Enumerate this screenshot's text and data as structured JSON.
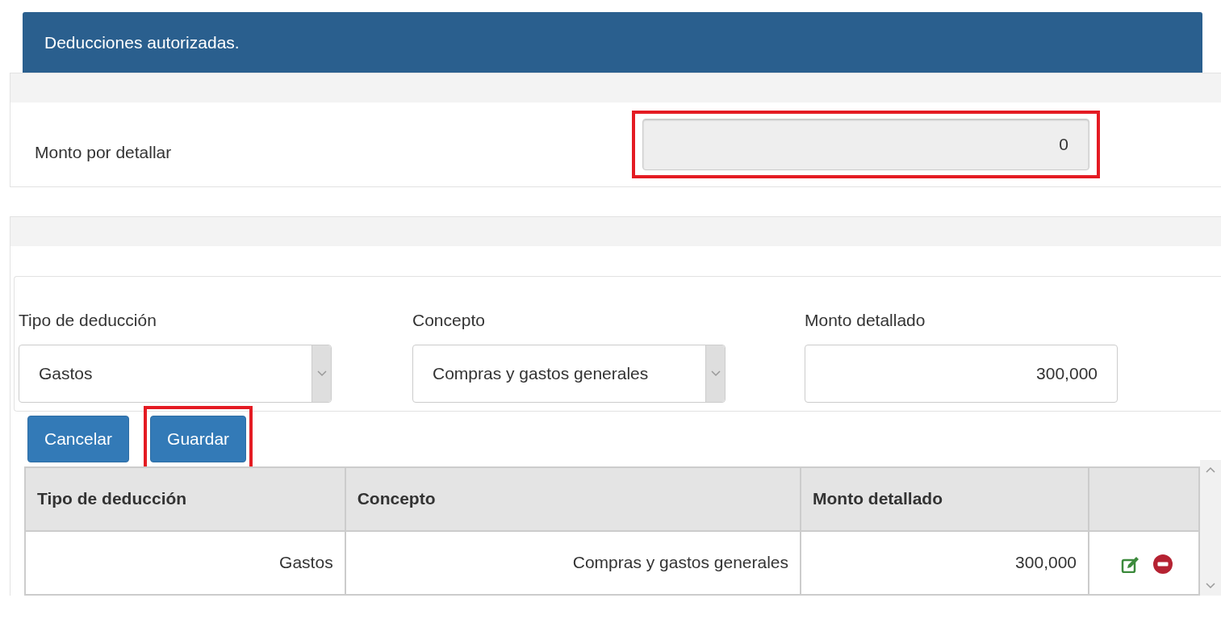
{
  "header": {
    "title": "Deducciones autorizadas."
  },
  "pending": {
    "label": "Monto por detallar",
    "value": "0",
    "disabled": true,
    "highlighted": true
  },
  "form": {
    "fields": [
      {
        "kind": "select",
        "label": "Tipo de deducción",
        "value": "Gastos"
      },
      {
        "kind": "select",
        "label": "Concepto",
        "value": "Compras y gastos generales"
      },
      {
        "kind": "input",
        "label": "Monto detallado",
        "value": "300,000"
      }
    ]
  },
  "buttons": [
    {
      "label": "Cancelar",
      "highlighted": false
    },
    {
      "label": "Guardar",
      "highlighted": true
    }
  ],
  "table": {
    "columns": [
      "Tipo de deducción",
      "Concepto",
      "Monto detallado"
    ],
    "rows": [
      {
        "cells": [
          "Gastos",
          "Compras y gastos generales",
          "300,000"
        ]
      }
    ]
  }
}
